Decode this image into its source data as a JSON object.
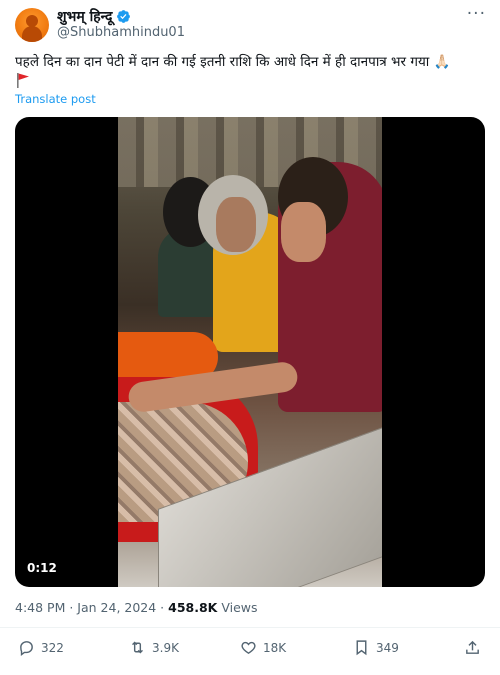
{
  "author": {
    "display_name": "शुभम् हिन्दू",
    "handle": "@Shubhamhindu01",
    "avatar_icon": "avatar-saffron",
    "verified_icon": "verified-badge-icon",
    "verified_color": "#1d9bf0"
  },
  "tweet": {
    "text": "पहले दिन का दान पेटी में दान की गई इतनी राशि कि आधे दिन में ही दानपात्र भर गया 🙏🏻",
    "trailing_emoji_icon": "red-flag-icon",
    "translate_label": "Translate post"
  },
  "media": {
    "type": "video",
    "duration": "0:12"
  },
  "meta": {
    "time": "4:48 PM",
    "separator": " · ",
    "date": "Jan 24, 2024",
    "views_count": "458.8K",
    "views_label": " Views"
  },
  "actions": {
    "reply_count": "322",
    "repost_count": "3.9K",
    "like_count": "18K",
    "bookmark_count": "349"
  },
  "colors": {
    "text_primary": "#0f1419",
    "text_secondary": "#536471",
    "link": "#1d9bf0"
  }
}
